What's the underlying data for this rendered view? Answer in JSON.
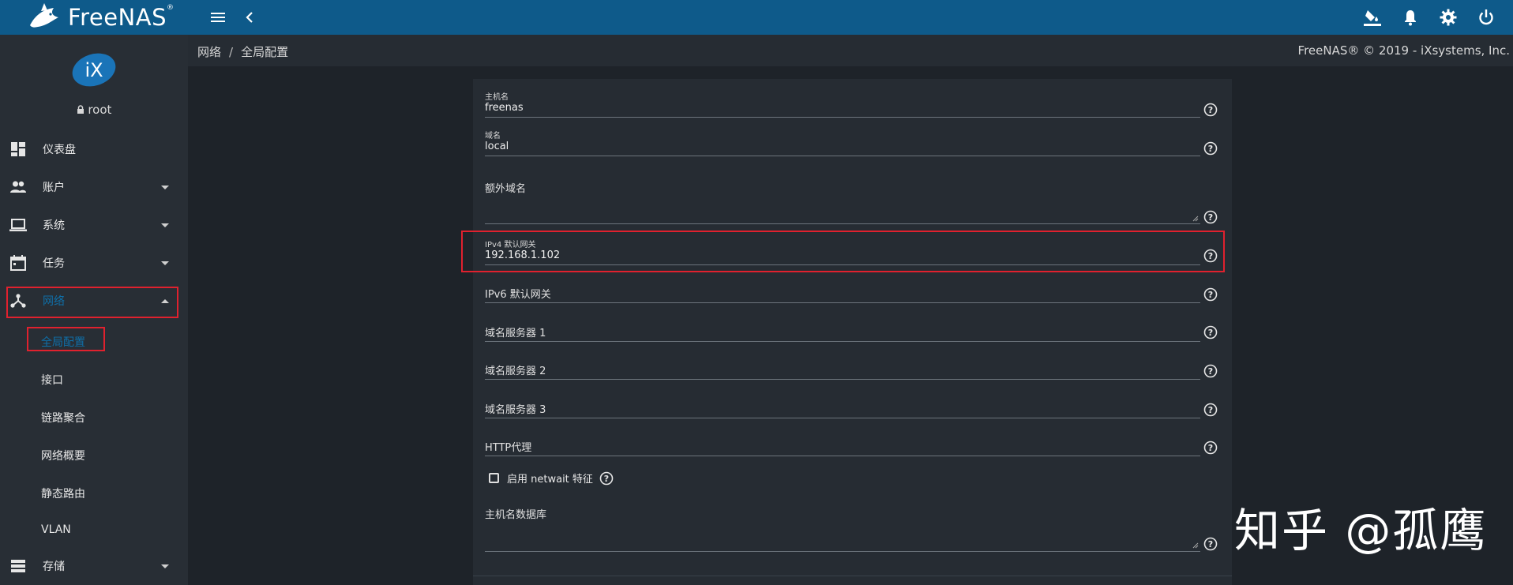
{
  "app": {
    "logo_text": "FreeNAS",
    "logo_mark": "®"
  },
  "topbar": {
    "icons": [
      "menu-icon",
      "chevron-left-icon",
      "paint-bucket-icon",
      "bell-icon",
      "gear-icon",
      "power-icon"
    ]
  },
  "sidebar": {
    "avatar_text": "iX",
    "user": "root",
    "items": [
      {
        "label": "仪表盘",
        "icon": "dashboard-icon"
      },
      {
        "label": "账户",
        "icon": "people-icon"
      },
      {
        "label": "系统",
        "icon": "laptop-icon"
      },
      {
        "label": "任务",
        "icon": "calendar-icon"
      },
      {
        "label": "网络",
        "icon": "network-icon"
      },
      {
        "label": "存储",
        "icon": "storage-icon"
      }
    ],
    "network_subitems": [
      "全局配置",
      "接口",
      "链路聚合",
      "网络概要",
      "静态路由",
      "VLAN"
    ]
  },
  "breadcrumb": {
    "root": "网络",
    "separator": "/",
    "current": "全局配置"
  },
  "copyright": "FreeNAS® © 2019 - iXsystems, Inc.",
  "form": {
    "hostname": {
      "label": "主机名",
      "value": "freenas"
    },
    "domain": {
      "label": "域名",
      "value": "local"
    },
    "additional_domains": {
      "placeholder": "额外域名"
    },
    "ipv4_gateway": {
      "label": "IPv4 默认网关",
      "value": "192.168.1.102"
    },
    "ipv6_gateway": {
      "placeholder": "IPv6 默认网关"
    },
    "nameserver1": {
      "placeholder": "域名服务器 1"
    },
    "nameserver2": {
      "placeholder": "域名服务器 2"
    },
    "nameserver3": {
      "placeholder": "域名服务器 3"
    },
    "http_proxy": {
      "placeholder": "HTTP代理"
    },
    "netwait": {
      "label": "启用 netwait 特征",
      "checked": false
    },
    "hosts_db": {
      "placeholder": "主机名数据库"
    }
  },
  "watermark": "知乎 @孤鹰",
  "colors": {
    "topbar": "#0e5a8a",
    "sidebar": "#282e35",
    "background": "#1e2329",
    "card": "#262c33",
    "highlight_box": "#e0212e",
    "active_text": "#0f6fa8"
  }
}
